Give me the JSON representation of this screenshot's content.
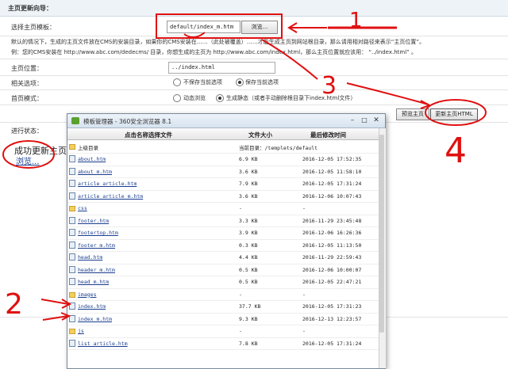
{
  "page": {
    "header": "主页更新向导：",
    "template_label": "选择主页模板：",
    "template_value": "default/index_m.htm",
    "browse_label": "浏览...",
    "note_line1": "默认的情况下，生成的主页文件放在CMS的安装目录，如果你的CMS安装在……（此处被覆盖）……才能生成主页到网站根目录，那么请用相对路径来表示“主页位置”。",
    "note_line2": "例：您的CMS安装在 http://www.abc.com/dedecms/ 目录，你想生成的主页为 http://www.abc.com/index.html，那么主页位置就应该用： “../index.html” 。",
    "position_label": "主页位置：",
    "position_value": "../index.html",
    "related_label": "相关选项：",
    "related_opt1": "不保存当前选项",
    "related_opt2": "保存当前选项",
    "mode_label": "首页模式：",
    "mode_opt1": "动态浏览",
    "mode_opt2": "生成静态（或者手动删除根目录下index.html文件）",
    "preview_btn": "预览主页",
    "update_btn": "更新主页HTML",
    "progress_label": "进行状态：",
    "progress_msg": "成功更新主页",
    "progress_link": "浏览..."
  },
  "dialog": {
    "title": "模板管理器 - 360安全浏览器 8.1",
    "col_name": "点击名称选择文件",
    "col_size": "文件大小",
    "col_time": "最后修改时间",
    "parent_label": "上级目录",
    "current_dir": "当前目录：/templets/default",
    "files": [
      {
        "name": "about.htm",
        "size": "6.9 KB",
        "time": "2016-12-05 17:52:35",
        "type": "file"
      },
      {
        "name": "about_m.htm",
        "size": "3.6 KB",
        "time": "2016-12-05 11:58:10",
        "type": "file"
      },
      {
        "name": "article_article.htm",
        "size": "7.9 KB",
        "time": "2016-12-05 17:31:24",
        "type": "file"
      },
      {
        "name": "article_article_m.htm",
        "size": "3.6 KB",
        "time": "2016-12-06 10:07:43",
        "type": "file"
      },
      {
        "name": "css",
        "size": "-",
        "time": "-",
        "type": "folder"
      },
      {
        "name": "footer.htm",
        "size": "3.3 KB",
        "time": "2016-11-29 23:45:48",
        "type": "file"
      },
      {
        "name": "footertop.htm",
        "size": "3.9 KB",
        "time": "2016-12-06 16:26:36",
        "type": "file"
      },
      {
        "name": "footer_m.htm",
        "size": "0.3 KB",
        "time": "2016-12-05 11:13:50",
        "type": "file"
      },
      {
        "name": "head.htm",
        "size": "4.4 KB",
        "time": "2016-11-29 22:59:43",
        "type": "file"
      },
      {
        "name": "header_m.htm",
        "size": "0.5 KB",
        "time": "2016-12-06 10:00:07",
        "type": "file"
      },
      {
        "name": "head_m.htm",
        "size": "0.5 KB",
        "time": "2016-12-05 22:47:21",
        "type": "file"
      },
      {
        "name": "images",
        "size": "-",
        "time": "-",
        "type": "folder"
      },
      {
        "name": "index.htm",
        "size": "37.7 KB",
        "time": "2016-12-05 17:31:23",
        "type": "file"
      },
      {
        "name": "index_m.htm",
        "size": "9.3 KB",
        "time": "2016-12-13 12:23:57",
        "type": "file"
      },
      {
        "name": "js",
        "size": "-",
        "time": "-",
        "type": "folder"
      },
      {
        "name": "list_article.htm",
        "size": "7.8 KB",
        "time": "2016-12-05 17:31:24",
        "type": "file"
      }
    ]
  },
  "annotations": {
    "n1": "1",
    "n2": "2",
    "n3": "3",
    "n4": "4",
    "color": "#e01010"
  }
}
